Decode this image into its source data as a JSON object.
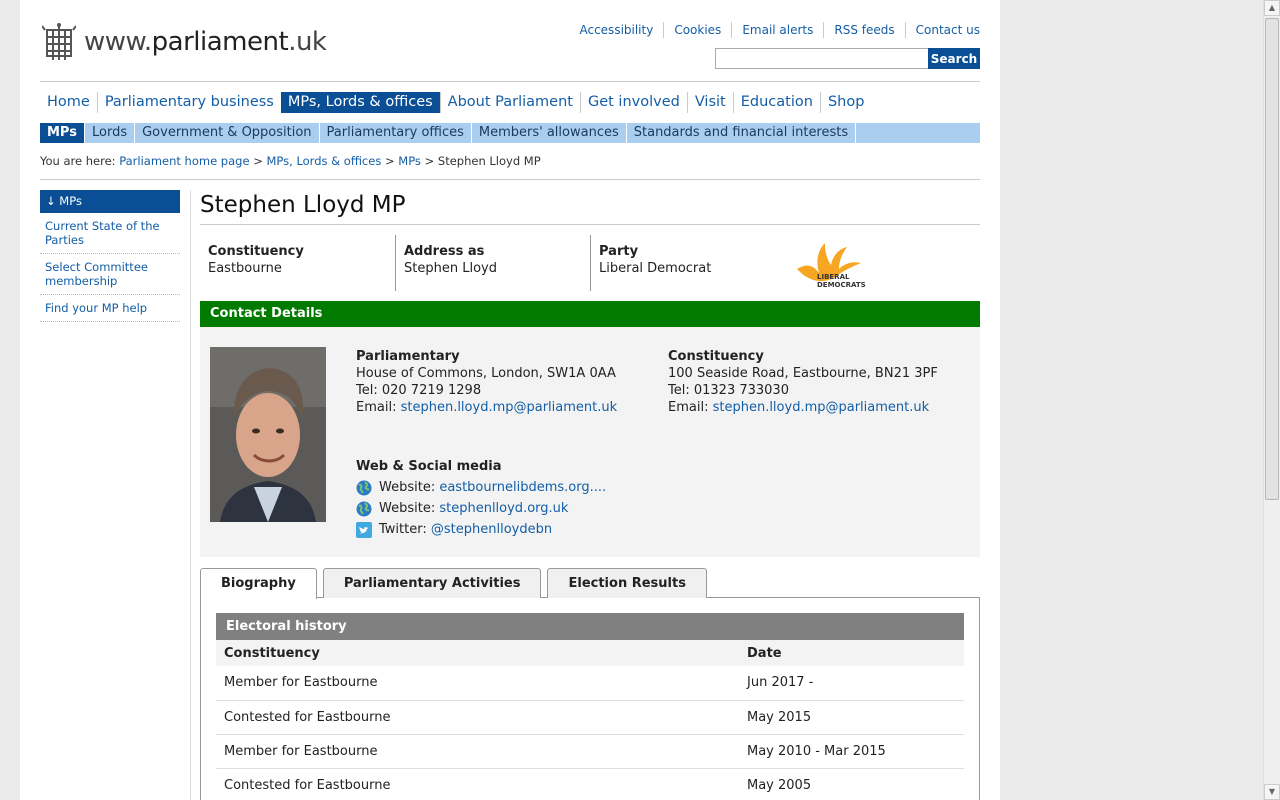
{
  "header": {
    "logo_text_pre": "www.",
    "logo_text_main": "parliament",
    "logo_text_post": ".uk",
    "utility_links": [
      "Accessibility",
      "Cookies",
      "Email alerts",
      "RSS feeds",
      "Contact us"
    ],
    "search_value": "",
    "search_button": "Search"
  },
  "mainnav": [
    "Home",
    "Parliamentary business",
    "MPs, Lords & offices",
    "About Parliament",
    "Get involved",
    "Visit",
    "Education",
    "Shop"
  ],
  "subnav": [
    "MPs",
    "Lords",
    "Government & Opposition",
    "Parliamentary offices",
    "Members' allowances",
    "Standards and financial interests"
  ],
  "breadcrumb": {
    "prefix": "You are here:",
    "links": [
      "Parliament home page",
      "MPs, Lords & offices",
      "MPs"
    ],
    "sep": ">",
    "current": "Stephen Lloyd MP"
  },
  "sidebar": {
    "heading": "↓ MPs",
    "items": [
      "Current State of the Parties",
      "Select Committee membership",
      "Find your MP help"
    ]
  },
  "mp": {
    "name": "Stephen Lloyd MP",
    "constituency_label": "Constituency",
    "constituency": "Eastbourne",
    "address_label": "Address as",
    "address_as": "Stephen Lloyd",
    "party_label": "Party",
    "party": "Liberal Democrat",
    "party_logo_line1": "LIBERAL",
    "party_logo_line2": "DEMOCRATS"
  },
  "contact": {
    "heading": "Contact Details",
    "parliamentary": {
      "label": "Parliamentary",
      "address": "House of Commons, London, SW1A 0AA",
      "tel": "Tel: 020 7219 1298",
      "email_label": "Email:",
      "email": "stephen.lloyd.mp@parliament.uk"
    },
    "constituency": {
      "label": "Constituency",
      "address": "100 Seaside Road, Eastbourne, BN21 3PF",
      "tel": "Tel: 01323 733030",
      "email_label": "Email:",
      "email": "stephen.lloyd.mp@parliament.uk"
    },
    "web": {
      "label": "Web & Social media",
      "items": [
        {
          "label": "Website:",
          "value": "eastbournelibdems.org...."
        },
        {
          "label": "Website:",
          "value": "stephenlloyd.org.uk"
        },
        {
          "label": "Twitter:",
          "value": "@stephenlloydebn"
        }
      ]
    }
  },
  "tabs": [
    "Biography",
    "Parliamentary Activities",
    "Election Results"
  ],
  "electoral_history": {
    "heading": "Electoral history",
    "columns": [
      "Constituency",
      "Date"
    ],
    "rows": [
      [
        "Member for Eastbourne",
        "Jun 2017 -"
      ],
      [
        "Contested for Eastbourne",
        "May 2015"
      ],
      [
        "Member for Eastbourne",
        "May 2010 - Mar 2015"
      ],
      [
        "Contested for Eastbourne",
        "May 2005"
      ]
    ]
  },
  "colors": {
    "nav_blue": "#0a4f96",
    "subnav_blue": "#a9ceef",
    "contact_green": "#007b00",
    "link": "#135ea6",
    "party_orange": "#f6a623"
  }
}
